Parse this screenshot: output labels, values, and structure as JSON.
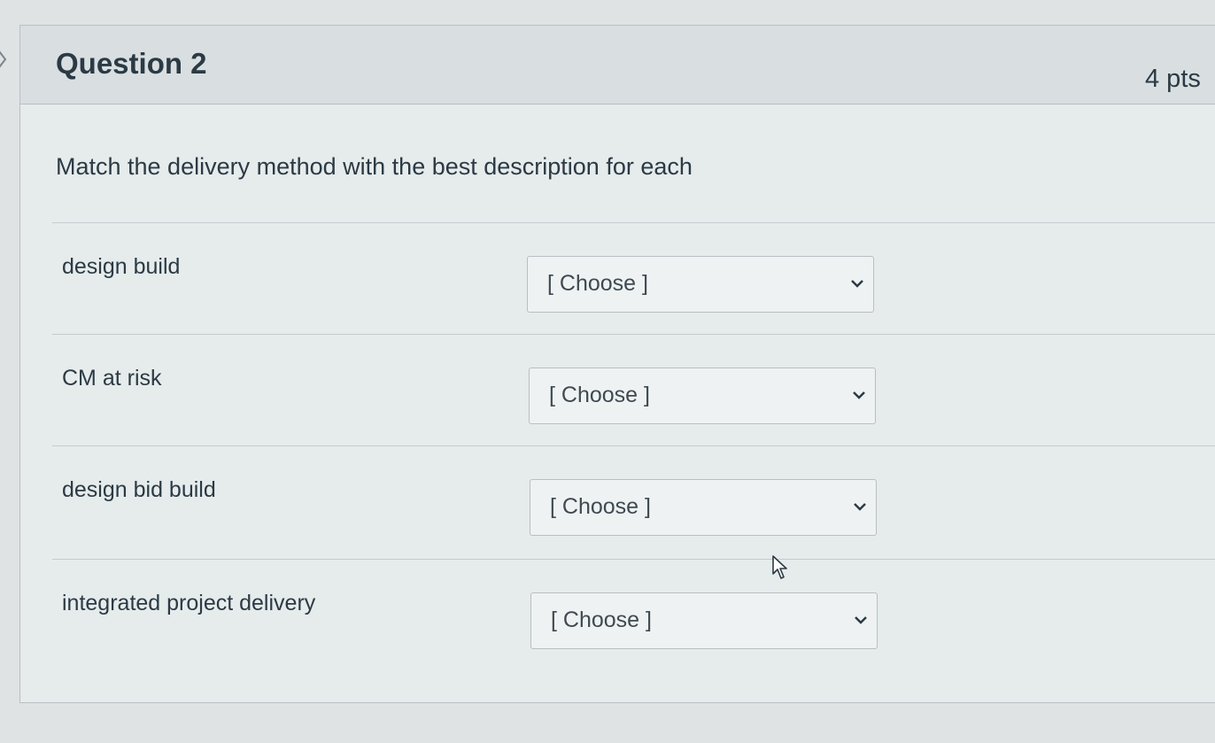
{
  "question": {
    "title": "Question 2",
    "points": "4 pts",
    "prompt": "Match the delivery method with the best description for each"
  },
  "matches": [
    {
      "label": "design build",
      "selected": "[ Choose ]"
    },
    {
      "label": "CM at risk",
      "selected": "[ Choose ]"
    },
    {
      "label": "design bid build",
      "selected": "[ Choose ]"
    },
    {
      "label": "integrated project delivery",
      "selected": "[ Choose ]"
    }
  ],
  "icons": {
    "dropdown": "chevron-down-icon",
    "pointer": "mouse-cursor-icon",
    "edge": "chevron-right-icon"
  },
  "colors": {
    "text": "#2b3a44",
    "border": "#b9bfc2",
    "header_bg": "#d9dfe1"
  }
}
